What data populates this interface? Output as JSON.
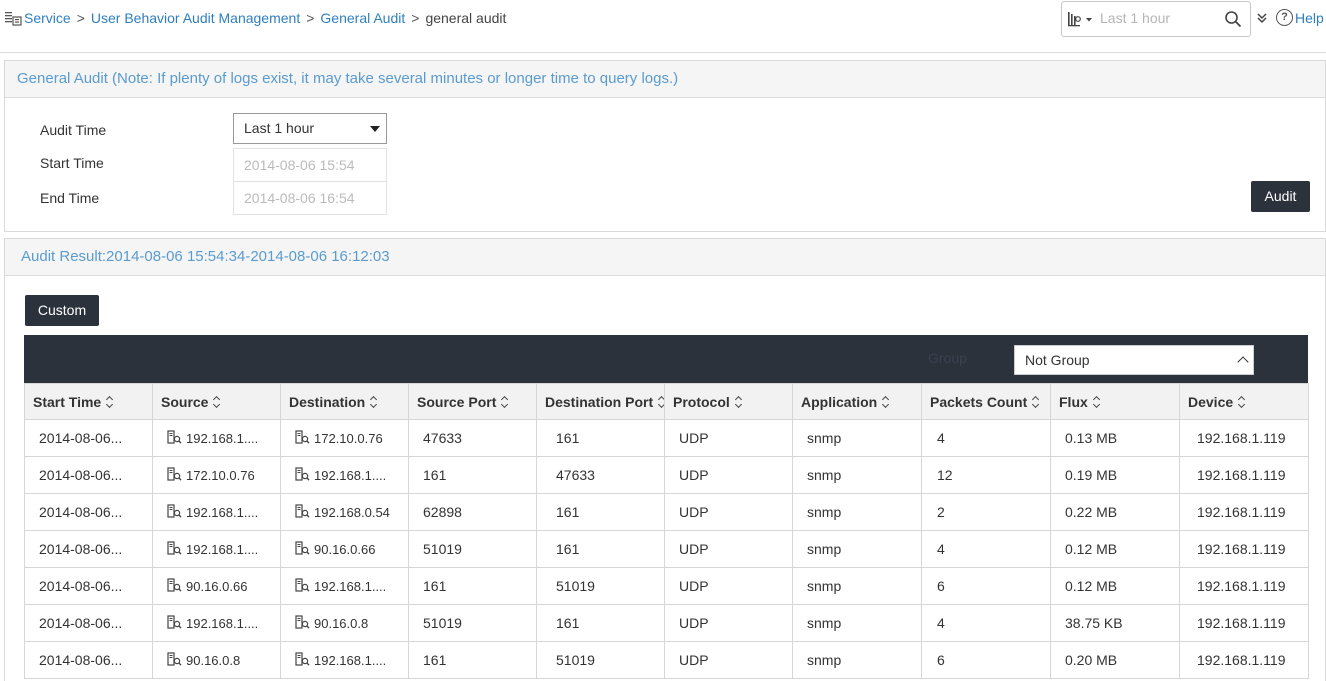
{
  "breadcrumb": {
    "items": [
      "Service",
      "User Behavior Audit Management",
      "General Audit"
    ],
    "separator": ">",
    "current": "general audit"
  },
  "search": {
    "placeholder": "Last 1 hour"
  },
  "help_label": "Help",
  "general_audit": {
    "title": "General Audit (Note: If plenty of logs exist, it may take several minutes or longer time to query logs.)",
    "audit_time_label": "Audit Time",
    "audit_time_value": "Last 1 hour",
    "start_time_label": "Start Time",
    "start_time_value": "2014-08-06 15:54",
    "end_time_label": "End Time",
    "end_time_value": "2014-08-06 16:54",
    "audit_button": "Audit"
  },
  "audit_result": {
    "title": "Audit Result:2014-08-06 15:54:34-2014-08-06 16:12:03",
    "custom_button": "Custom",
    "group_label": "Group",
    "group_value": "Not Group",
    "columns": [
      "Start Time",
      "Source",
      "Destination",
      "Source Port",
      "Destination Port",
      "Protocol",
      "Application",
      "Packets Count",
      "Flux",
      "Device"
    ],
    "rows": [
      [
        "2014-08-06...",
        "192.168.1....",
        "172.10.0.76",
        "47633",
        "161",
        "UDP",
        "snmp",
        "4",
        "0.13 MB",
        "192.168.1.119"
      ],
      [
        "2014-08-06...",
        "172.10.0.76",
        "192.168.1....",
        "161",
        "47633",
        "UDP",
        "snmp",
        "12",
        "0.19 MB",
        "192.168.1.119"
      ],
      [
        "2014-08-06...",
        "192.168.1....",
        "192.168.0.54",
        "62898",
        "161",
        "UDP",
        "snmp",
        "2",
        "0.22 MB",
        "192.168.1.119"
      ],
      [
        "2014-08-06...",
        "192.168.1....",
        "90.16.0.66",
        "51019",
        "161",
        "UDP",
        "snmp",
        "4",
        "0.12 MB",
        "192.168.1.119"
      ],
      [
        "2014-08-06...",
        "90.16.0.66",
        "192.168.1....",
        "161",
        "51019",
        "UDP",
        "snmp",
        "6",
        "0.12 MB",
        "192.168.1.119"
      ],
      [
        "2014-08-06...",
        "192.168.1....",
        "90.16.0.8",
        "51019",
        "161",
        "UDP",
        "snmp",
        "4",
        "38.75 KB",
        "192.168.1.119"
      ],
      [
        "2014-08-06...",
        "90.16.0.8",
        "192.168.1....",
        "161",
        "51019",
        "UDP",
        "snmp",
        "6",
        "0.20 MB",
        "192.168.1.119"
      ]
    ]
  },
  "colors": {
    "link": "#2f7fc0",
    "panel_title": "#5a9bd0",
    "dark": "#2c323c"
  }
}
